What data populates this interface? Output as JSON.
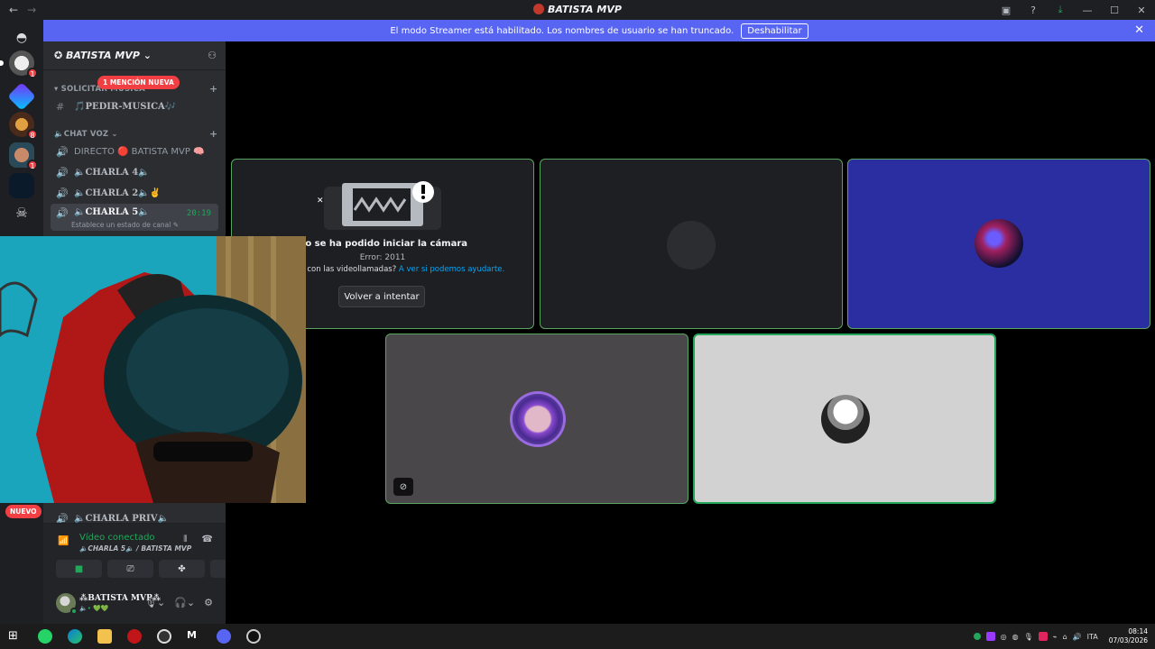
{
  "window": {
    "title": "BATISTA MVP"
  },
  "banner": {
    "text": "El modo Streamer está habilitado. Los nombres de usuario se han truncado.",
    "button": "Deshabilitar"
  },
  "servers": {
    "badges": [
      "1",
      "8",
      "1"
    ]
  },
  "sidebar": {
    "guild_name": "BATISTA MVP",
    "mention_pill": "1 MENCIÓN NUEVA",
    "new_pill": "NUEVO",
    "categories": [
      {
        "label": "SOLICITAR MUSICA"
      },
      {
        "label": "CHAT VOZ"
      }
    ],
    "channels": [
      {
        "name": "🎵PEDIR-MUSICA🎶"
      },
      {
        "name": "DIRECTO 🔴 BATISTA MVP 🧠"
      },
      {
        "name": "🔈CHARLA 4🔈"
      },
      {
        "name": "🔈CHARLA 2🔈✌"
      },
      {
        "name": "🔈CHARLA 5🔈",
        "time": "20:19",
        "status": "Establece un estado de canal"
      },
      {
        "name": "🔈CHARLA PRIV🔈"
      }
    ]
  },
  "voice": {
    "connected": "Vídeo conectado",
    "location": "🔈CHARLA 5🔈 / BATISTA MVP"
  },
  "user": {
    "name": "⁂BATISTA MVP⁂",
    "status": "🔈• 💚💚"
  },
  "stage": {
    "error_title": "No se ha podido iniciar la cámara",
    "error_code": "Error: 2011",
    "error_help": "¿Problemas con las videollamadas?",
    "error_link": "A ver si podemos ayudarte.",
    "retry": "Volver a intentar"
  },
  "taskbar": {
    "lang": "ITA",
    "time": "08:14",
    "date": "07/03/2026"
  },
  "colors": {
    "accent": "#5865f2",
    "speaking": "#23a55a",
    "danger": "#f23f43"
  }
}
